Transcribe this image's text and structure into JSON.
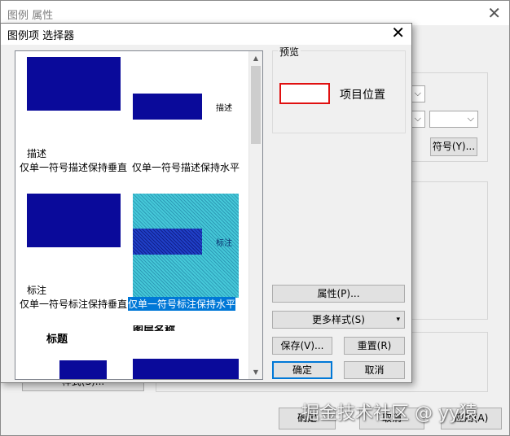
{
  "parent": {
    "title": "图例 属性",
    "symbol_button": "符号(Y)...",
    "style_button_partial": "样式(S)...",
    "ok": "确定",
    "cancel": "取消",
    "apply": "应用(A)"
  },
  "dialog": {
    "title": "图例项 选择器",
    "gallery": [
      {
        "desc": "描述",
        "caption": "仅单一符号描述保持垂直"
      },
      {
        "desc": "描述",
        "caption": "仅单一符号描述保持水平"
      },
      {
        "desc": "标注",
        "caption": "仅单一符号标注保持垂直"
      },
      {
        "desc": "标注",
        "caption": "仅单一符号标注保持水平",
        "selected": true
      },
      {
        "desc": "标题"
      },
      {
        "desc": "图层名称"
      }
    ],
    "preview": {
      "legend": "预览",
      "text": "项目位置"
    },
    "buttons": {
      "properties": "属性(P)...",
      "more_styles": "更多样式(S)",
      "save": "保存(V)...",
      "reset": "重置(R)",
      "ok": "确定",
      "cancel": "取消"
    }
  },
  "watermark": "掘金技术社区 @ yy猿",
  "colors": {
    "swatch": "#0a0a9a",
    "selection": "#0078d7",
    "preview_border": "#e01010"
  }
}
